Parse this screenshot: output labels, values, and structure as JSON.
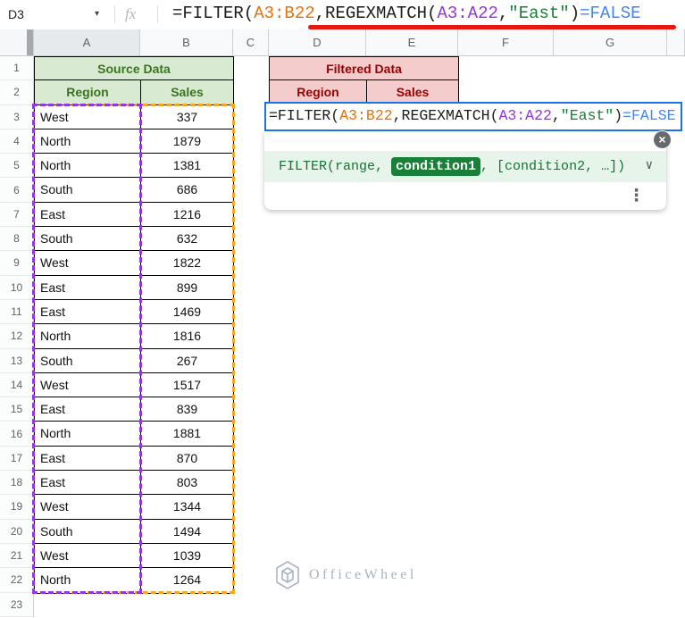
{
  "formula_bar": {
    "cell_reference": "D3",
    "fx_label": "fx"
  },
  "formula": {
    "full_text": "=FILTER(A3:B22,REGEXMATCH(A3:A22,\"East\")=FALSE",
    "segments": [
      {
        "text": "=FILTER(",
        "color": "plain"
      },
      {
        "text": "A3:B22",
        "color": "range1"
      },
      {
        "text": ",",
        "color": "plain"
      },
      {
        "text": "REGEXMATCH(",
        "color": "plain"
      },
      {
        "text": "A3:A22",
        "color": "range2"
      },
      {
        "text": ",",
        "color": "plain"
      },
      {
        "text": "\"East\"",
        "color": "string"
      },
      {
        "text": ")",
        "color": "plain"
      },
      {
        "text": "=FALSE",
        "color": "bool"
      }
    ]
  },
  "grid": {
    "column_labels": [
      "A",
      "B",
      "C",
      "D",
      "E",
      "F",
      "G",
      ""
    ],
    "row_labels": [
      "1",
      "2",
      "3",
      "4",
      "5",
      "6",
      "7",
      "8",
      "9",
      "10",
      "11",
      "12",
      "13",
      "14",
      "15",
      "16",
      "17",
      "18",
      "19",
      "20",
      "21",
      "22",
      "23"
    ]
  },
  "source_table": {
    "title": "Source Data",
    "headers": [
      "Region",
      "Sales"
    ],
    "rows": [
      [
        "West",
        "337"
      ],
      [
        "North",
        "1879"
      ],
      [
        "North",
        "1381"
      ],
      [
        "South",
        "686"
      ],
      [
        "East",
        "1216"
      ],
      [
        "South",
        "632"
      ],
      [
        "West",
        "1822"
      ],
      [
        "East",
        "899"
      ],
      [
        "East",
        "1469"
      ],
      [
        "North",
        "1816"
      ],
      [
        "South",
        "267"
      ],
      [
        "West",
        "1517"
      ],
      [
        "East",
        "839"
      ],
      [
        "North",
        "1881"
      ],
      [
        "East",
        "870"
      ],
      [
        "East",
        "803"
      ],
      [
        "West",
        "1344"
      ],
      [
        "South",
        "1494"
      ],
      [
        "West",
        "1039"
      ],
      [
        "North",
        "1264"
      ]
    ]
  },
  "filtered_table": {
    "title": "Filtered Data",
    "headers": [
      "Region",
      "Sales"
    ]
  },
  "help": {
    "pre": "FILTER(range, ",
    "chip": "condition1",
    "post": ", [condition2, …])"
  },
  "icons": {
    "close": "×",
    "chevron": "∨",
    "dropdown": "▾",
    "more_options": "⋮"
  },
  "watermark": {
    "text": "OfficeWheel"
  },
  "colors": {
    "plain": "#1b1b1b",
    "range1": "#e8710a",
    "range2": "#9334e6",
    "string": "#188038",
    "bool": "#4285f4",
    "accent_blue": "#1a73e8",
    "annotation_red": "#e81710",
    "dashed_orange": "#f5a623",
    "dashed_purple": "#9334e6",
    "source_header_bg": "#d9ead3",
    "source_header_text": "#38761d",
    "filtered_header_bg": "#f4cccc",
    "filtered_header_text": "#990000",
    "help_bg": "#e6f4ea",
    "help_text": "#137333",
    "chip_bg": "#188038"
  }
}
